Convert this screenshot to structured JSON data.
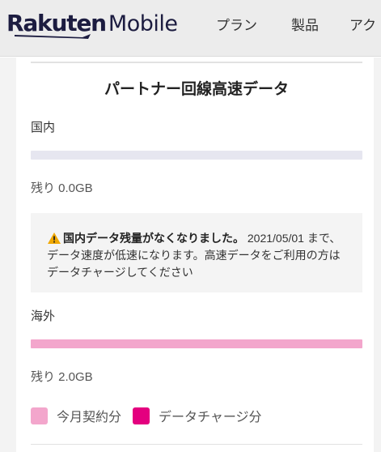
{
  "header": {
    "logo": {
      "rakuten": "Rakuten",
      "mobile": "Mobile"
    },
    "nav": [
      {
        "label": "プラン"
      },
      {
        "label": "製品"
      },
      {
        "label": "アク"
      }
    ]
  },
  "card": {
    "title": "パートナー回線高速データ",
    "domestic": {
      "label": "国内",
      "remaining": "残り 0.0GB",
      "usage_fraction": 0.0
    },
    "notice": {
      "strong": "国内データ残量がなくなりました。",
      "text": "2021/05/01 まで、データ速度が低速になります。高速データをご利用の方はデータチャージしてください",
      "icon": "warning-icon"
    },
    "overseas": {
      "label": "海外",
      "remaining": "残り 2.0GB",
      "usage_fraction": 1.0
    },
    "legend": [
      {
        "label": "今月契約分",
        "color": "#f3a6cc"
      },
      {
        "label": "データチャージ分",
        "color": "#e4007f"
      }
    ]
  },
  "colors": {
    "brand_dark": "#1c1c40",
    "brand_magenta": "#e4007f",
    "contract_pink": "#f3a6cc",
    "empty_bar": "#e6e6f0"
  }
}
